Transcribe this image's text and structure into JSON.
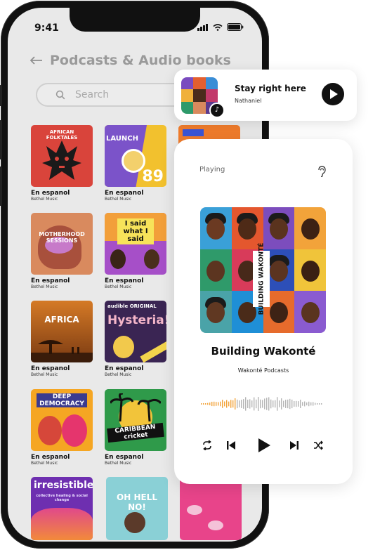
{
  "status": {
    "time": "9:41"
  },
  "header": {
    "title": "Podcasts & Audio books"
  },
  "search": {
    "placeholder": "Search"
  },
  "grid": [
    {
      "title": "En espanol",
      "subtitle": "Bethel Music",
      "cover_text": "AFRICAN FOLKTALES",
      "bg": "#d9443b"
    },
    {
      "title": "En espanol",
      "subtitle": "Bethel Music",
      "cover_text": "LAUNCH",
      "number": "89",
      "bg": "#f2c12e"
    },
    {
      "title": "En espanol",
      "subtitle": "Bethel Music",
      "cover_text": "MOTHERHOOD SESSIONS",
      "bg": "#d98a5e"
    },
    {
      "title": "En espanol",
      "subtitle": "Bethel Music",
      "cover_text": "I said what I said",
      "bg": "#a64fc8"
    },
    {
      "title": "En espanol",
      "subtitle": "Bethel Music",
      "cover_text": "AFRICA",
      "bg": "#c9711f"
    },
    {
      "title": "En espanol",
      "subtitle": "Bethel Music",
      "cover_text": "Hysteria!",
      "cover_sub": "audible ORIGINAL",
      "bg": "#3a2553"
    },
    {
      "title": "En espanol",
      "subtitle": "Bethel Music",
      "cover_text": "DEEP DEMOCRACY",
      "bg": "#f5a623"
    },
    {
      "title": "En espanol",
      "subtitle": "Bethel Music",
      "cover_text": "CARIBBEAN cricket",
      "bg": "#2f9a4a"
    },
    {
      "title": "",
      "subtitle": "",
      "cover_text": "irresistible",
      "cover_sub": "collective healing & social change",
      "bg": "#6e2fb0"
    },
    {
      "title": "",
      "subtitle": "",
      "cover_text": "OH HELL NO!",
      "bg": "#8ad0d6"
    }
  ],
  "mini_player": {
    "title": "Stay right here",
    "artist": "Nathaniel"
  },
  "player": {
    "label": "Playing",
    "title": "Building Wakonté",
    "artist": "Wakonté Podcasts",
    "art_text": "BUILDING WAKONTÉ"
  },
  "colors": {
    "accent": "#f2a33a",
    "wave_inactive": "#b5b5b5"
  },
  "icons": [
    "back-arrow-icon",
    "search-icon",
    "play-icon",
    "repeat-icon",
    "skip-back-icon",
    "skip-forward-icon",
    "shuffle-icon",
    "ear-icon",
    "music-note-icon"
  ]
}
